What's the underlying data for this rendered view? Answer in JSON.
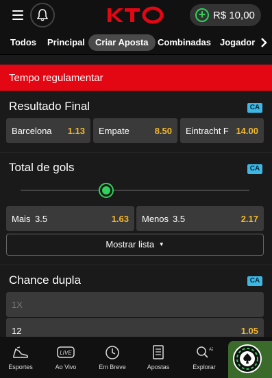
{
  "header": {
    "balance": "R$ 10,00"
  },
  "tabs": [
    "Todos",
    "Principal",
    "Criar Aposta",
    "Combinadas",
    "Jogador"
  ],
  "banner": "Tempo regulamentar",
  "ca_badge": "CA",
  "resultado": {
    "title": "Resultado Final",
    "options": [
      {
        "label": "Barcelona",
        "odd": "1.13"
      },
      {
        "label": "Empate",
        "odd": "8.50"
      },
      {
        "label": "Eintracht F",
        "odd": "14.00"
      }
    ]
  },
  "gols": {
    "title": "Total de gols",
    "over": {
      "label": "Mais",
      "line": "3.5",
      "odd": "1.63"
    },
    "under": {
      "label": "Menos",
      "line": "3.5",
      "odd": "2.17"
    },
    "show_list": "Mostrar lista"
  },
  "chance": {
    "title": "Chance dupla",
    "rows": [
      {
        "label": "1X",
        "odd": ""
      },
      {
        "label": "12",
        "odd": "1.05"
      }
    ]
  },
  "bottom_nav": [
    "Esportes",
    "Ao Vivo",
    "Em Breve",
    "Apostas",
    "Explorar"
  ],
  "colors": {
    "accent": "#2fd35a",
    "brand_red": "#e30613",
    "odd": "#f5b82e",
    "badge": "#3db7e4"
  }
}
